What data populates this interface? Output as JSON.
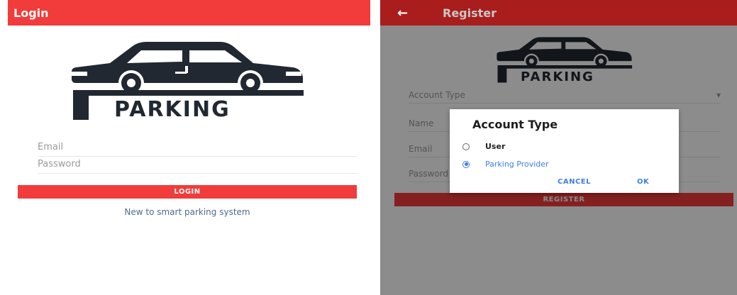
{
  "login": {
    "title": "Login",
    "logo_text": "PARKING",
    "email_placeholder": "Email",
    "password_placeholder": "Password",
    "login_button": "LOGIN",
    "register_link": "New to smart parking system",
    "accent_color": "#f23b3b"
  },
  "register": {
    "title": "Register",
    "back_icon": "arrow-left-icon",
    "logo_text": "PARKING",
    "account_type_label": "Account Type",
    "name_label": "Name",
    "email_label": "Email",
    "password_label": "Password",
    "register_button": "REGISTER",
    "toolbar_color": "#a91d1d"
  },
  "dialog": {
    "title": "Account Type",
    "options": [
      {
        "label": "User",
        "selected": false
      },
      {
        "label": "Parking Provider",
        "selected": true
      }
    ],
    "cancel_label": "CANCEL",
    "ok_label": "OK",
    "accent_color": "#3f7ee8"
  }
}
